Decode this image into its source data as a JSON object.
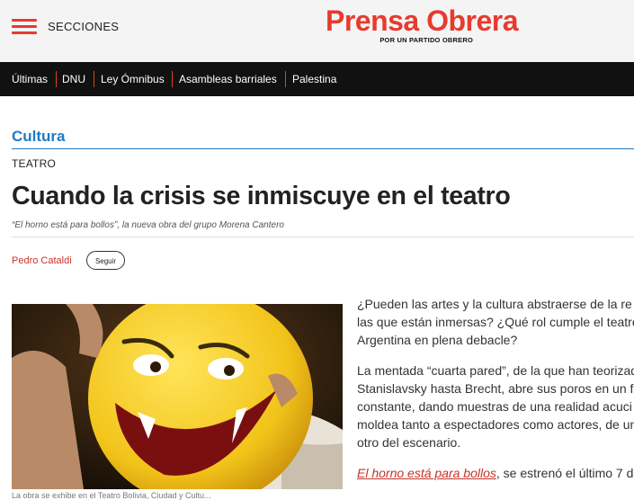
{
  "header": {
    "menu_label": "SECCIONES",
    "logo_main": "Prensa Obrera",
    "logo_sub": "POR UN PARTIDO OBRERO",
    "brand_color": "#e63b2e"
  },
  "nav": {
    "items": [
      "Últimas",
      "DNU",
      "Ley Ómnibus",
      "Asambleas barriales",
      "Palestina"
    ]
  },
  "article": {
    "category": "Cultura",
    "subcategory": "TEATRO",
    "title": "Cuando la crisis se inmiscuye en el teatro",
    "subtitle": "“El horno está para bollos”, la nueva obra del grupo Morena Cantero",
    "author": "Pedro Cataldi",
    "follow_label": "Seguir",
    "image_caption": "La obra se exhibe en el Teatro Bolivia, Ciudad y Cultu...",
    "paragraphs": {
      "p1": [
        "¿Pueden las artes y la cultura abstraerse de la re",
        "las que están inmersas? ¿Qué rol cumple el teatro",
        "Argentina en plena debacle?"
      ],
      "p2": [
        "La mentada “cuarta pared”, de la que han teorizad",
        "Stanislavsky hasta Brecht, abre sus poros en un f",
        "constante, dando muestras de una realidad acuci",
        "moldea tanto a espectadores como actores, de un",
        "otro del escenario."
      ],
      "p3_link": "El horno está para bollos",
      "p3_rest": ", se estrenó el último 7 d"
    }
  },
  "colors": {
    "category_blue": "#1e7bc4",
    "link_red": "#c8322a",
    "nav_bg": "#111111"
  }
}
